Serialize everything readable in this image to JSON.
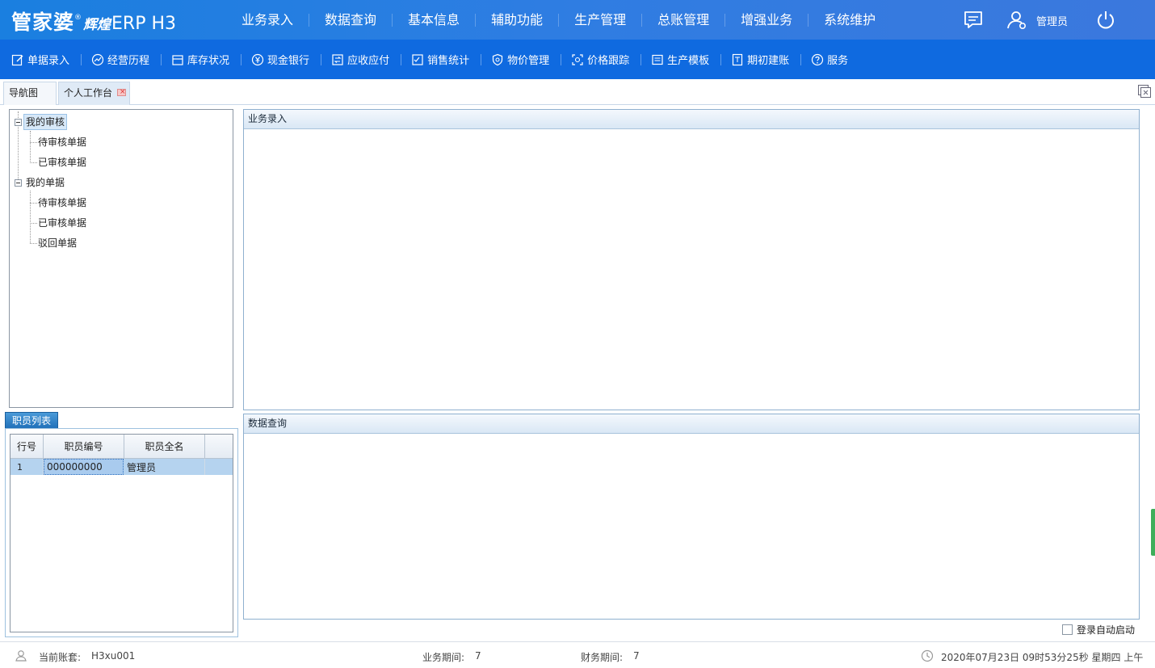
{
  "app": {
    "brand": "管家婆",
    "brand_sub": "辉煌",
    "product": "ERP H3",
    "reg_mark": "®"
  },
  "topnav": [
    {
      "label": "业务录入"
    },
    {
      "label": "数据查询"
    },
    {
      "label": "基本信息"
    },
    {
      "label": "辅助功能"
    },
    {
      "label": "生产管理"
    },
    {
      "label": "总账管理"
    },
    {
      "label": "增强业务"
    },
    {
      "label": "系统维护"
    }
  ],
  "user": {
    "name": "管理员"
  },
  "toolbar": [
    {
      "label": "单据录入",
      "icon": "edit-icon"
    },
    {
      "label": "经营历程",
      "icon": "trend-icon"
    },
    {
      "label": "库存状况",
      "icon": "inventory-icon"
    },
    {
      "label": "现金银行",
      "icon": "yen-icon"
    },
    {
      "label": "应收应付",
      "icon": "exchange-icon"
    },
    {
      "label": "销售统计",
      "icon": "checklist-icon"
    },
    {
      "label": "物价管理",
      "icon": "shield-icon"
    },
    {
      "label": "价格跟踪",
      "icon": "target-icon"
    },
    {
      "label": "生产模板",
      "icon": "template-icon"
    },
    {
      "label": "期初建账",
      "icon": "ledger-icon"
    },
    {
      "label": "服务",
      "icon": "help-icon"
    }
  ],
  "tabs": [
    {
      "label": "导航图"
    },
    {
      "label": "个人工作台"
    }
  ],
  "tree": {
    "groups": [
      {
        "label": "我的审核",
        "children": [
          "待审核单据",
          "已审核单据"
        ]
      },
      {
        "label": "我的单据",
        "children": [
          "待审核单据",
          "已审核单据",
          "驳回单据"
        ]
      }
    ]
  },
  "staff": {
    "tab_label": "职员列表",
    "columns": [
      "行号",
      "职员编号",
      "职员全名"
    ],
    "rows": [
      {
        "row_no": "1",
        "code": "000000000",
        "name": "管理员"
      }
    ]
  },
  "panels": {
    "entry_title": "业务录入",
    "query_title": "数据查询"
  },
  "autostart_label": "登录自动启动",
  "status": {
    "account_label": "当前账套:",
    "account_value": "H3xu001",
    "biz_period_label": "业务期间:",
    "biz_period_value": "7",
    "fin_period_label": "财务期间:",
    "fin_period_value": "7",
    "datetime": "2020年07月23日 09时53分25秒 星期四 上午"
  },
  "colors": {
    "topbar": "#2f7de2",
    "toolbar": "#0f6ae0",
    "selection": "#b5d3ef"
  }
}
